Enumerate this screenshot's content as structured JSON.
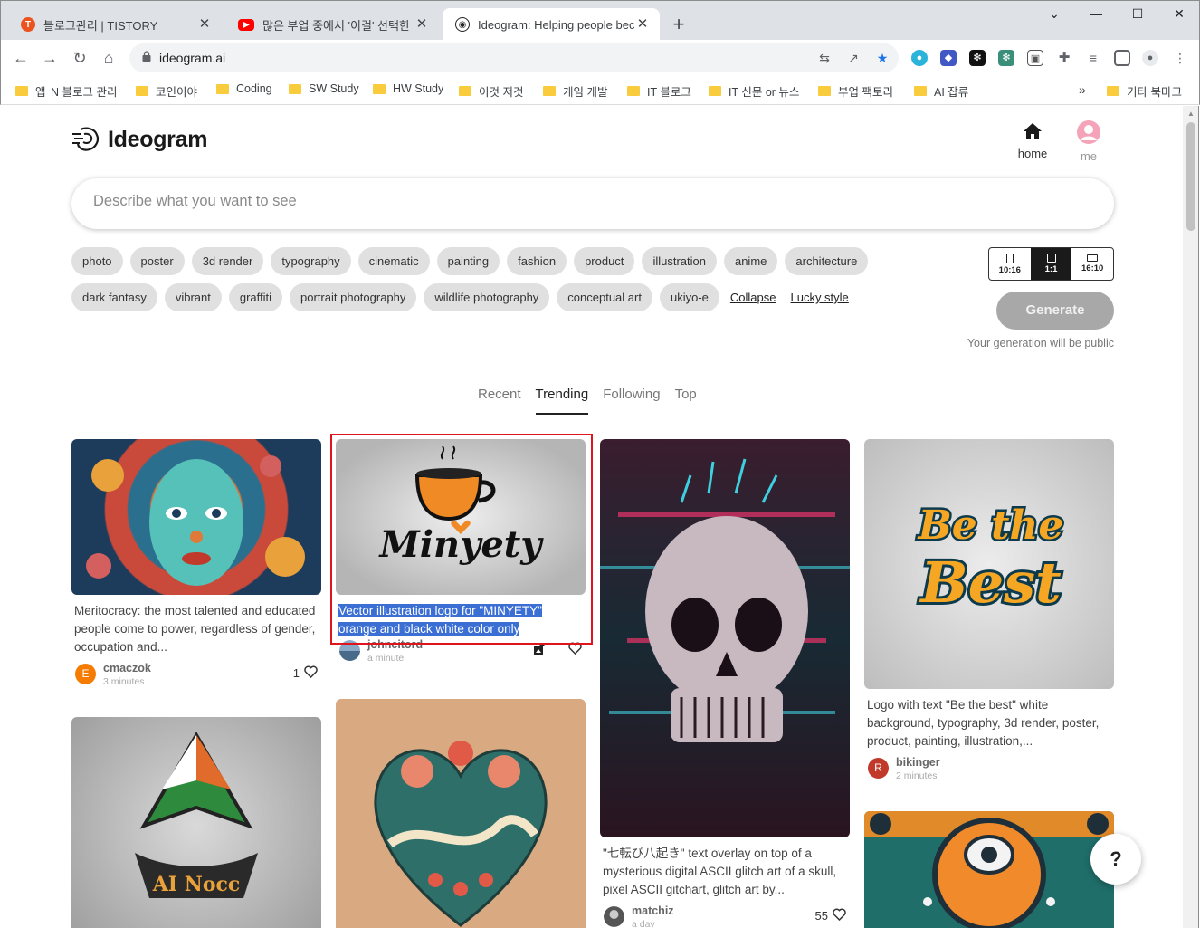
{
  "browser": {
    "tabs": [
      {
        "title": "블로그관리 | TISTORY",
        "favicon": "tistory-icon",
        "color": "#eb531f",
        "active": false
      },
      {
        "title": "많은 부업 중에서 '이걸' 선택한 이",
        "favicon": "youtube-icon",
        "color": "#ff0000",
        "active": false
      },
      {
        "title": "Ideogram: Helping people beco",
        "favicon": "ideogram-icon",
        "color": "#222222",
        "active": true
      }
    ],
    "url": "ideogram.ai",
    "bookmarks": [
      "앱",
      "N 블로그 관리",
      "코인이야",
      "Coding",
      "SW Study",
      "HW Study",
      "이것 저것",
      "게임 개발",
      "IT 블로그",
      "IT 신문 or 뉴스",
      "부업 팩토리",
      "AI 잡류"
    ],
    "bookmarks_overflow": "»",
    "other_bookmarks": "기타 북마크"
  },
  "header": {
    "logo_text": "Ideogram",
    "nav_home": "home",
    "nav_me": "me"
  },
  "prompt": {
    "placeholder": "Describe what you want to see"
  },
  "style_chips": {
    "row1": [
      "photo",
      "poster",
      "3d render",
      "typography",
      "cinematic",
      "painting",
      "fashion",
      "product",
      "illustration",
      "anime",
      "architecture"
    ],
    "row2": [
      "dark fantasy",
      "vibrant",
      "graffiti",
      "portrait photography",
      "wildlife photography",
      "conceptual art",
      "ukiyo-e"
    ],
    "collapse_label": "Collapse",
    "lucky_label": "Lucky style"
  },
  "aspect_ratio": {
    "options": [
      "10:16",
      "1:1",
      "16:10"
    ],
    "selected": "1:1"
  },
  "generate": {
    "label": "Generate",
    "note": "Your generation will be public"
  },
  "feed_tabs": [
    "Recent",
    "Trending",
    "Following",
    "Top"
  ],
  "feed_active_tab": "Trending",
  "cards": [
    {
      "caption": "Meritocracy: the most talented and educated people come to power, regardless of gender, occupation and...",
      "user": "cmaczok",
      "time": "3 minutes",
      "likes": "1",
      "avatar_letter": "E",
      "avatar_color": "#f57c00"
    },
    {
      "caption_line1": "Vector illustration logo for \"MINYETY\"",
      "caption_line2": "orange and black white color only",
      "user": "johncitord",
      "time": "a minute",
      "likes": "",
      "logo_text": "Minyety"
    },
    {
      "caption": "\"七転び八起き\" text overlay on top of a mysterious digital ASCII glitch art of a skull, pixel ASCII gitchart, glitch art by...",
      "user": "matchiz",
      "time": "a day",
      "likes": "55"
    },
    {
      "caption": "Logo with text \"Be the best\" white background, typography, 3d render, poster, product, painting, illustration,...",
      "user": "bikinger",
      "time": "2 minutes",
      "likes": "",
      "avatar_letter": "R",
      "avatar_color": "#c0392b",
      "art_text_1": "Be the",
      "art_text_2": "Best"
    },
    {
      "art_text": "AI Nocc"
    }
  ],
  "help_label": "?"
}
